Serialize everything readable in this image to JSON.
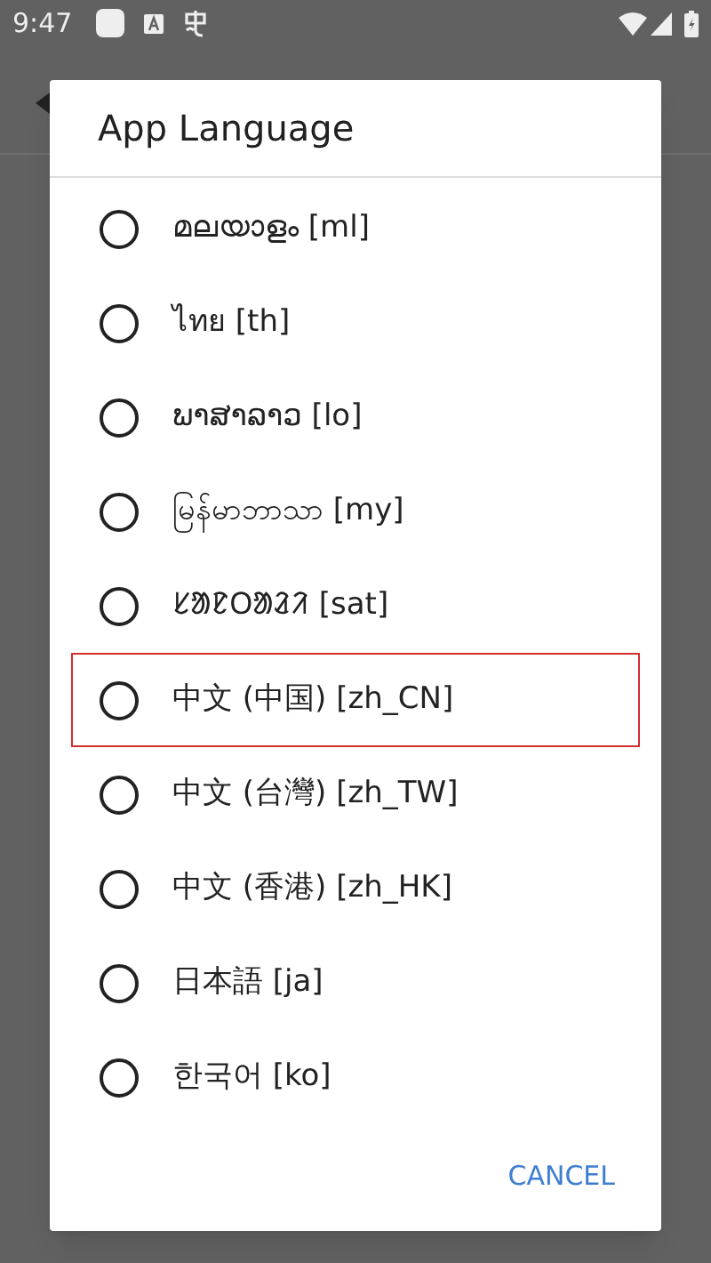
{
  "status_bar": {
    "time": "9:47"
  },
  "dialog": {
    "title": "App Language",
    "options": [
      {
        "label": "മലയാളം [ml]",
        "selected": false,
        "highlighted": false
      },
      {
        "label": "ไทย [th]",
        "selected": false,
        "highlighted": false
      },
      {
        "label": "ພາສາລາວ [lo]",
        "selected": false,
        "highlighted": false
      },
      {
        "label": "မြန်မာဘာသာ [my]",
        "selected": false,
        "highlighted": false
      },
      {
        "label": "ᱥᱟᱱᱛᱟᱲᱤ [sat]",
        "selected": false,
        "highlighted": false
      },
      {
        "label": "中文 (中国) [zh_CN]",
        "selected": false,
        "highlighted": true
      },
      {
        "label": "中文 (台灣) [zh_TW]",
        "selected": false,
        "highlighted": false
      },
      {
        "label": "中文 (香港) [zh_HK]",
        "selected": false,
        "highlighted": false
      },
      {
        "label": "日本語 [ja]",
        "selected": false,
        "highlighted": false
      },
      {
        "label": "한국어 [ko]",
        "selected": false,
        "highlighted": false
      }
    ],
    "buttons": [
      "CANCEL"
    ]
  }
}
